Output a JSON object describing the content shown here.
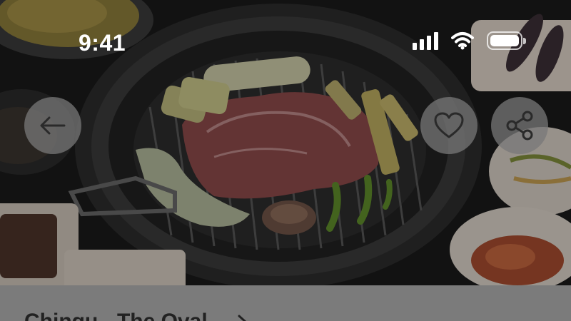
{
  "status_bar": {
    "time": "9:41",
    "icons": [
      "cellular-signal-icon",
      "wifi-icon",
      "battery-icon"
    ]
  },
  "hero": {
    "icon": "korean-bbq-grill-photo"
  },
  "actions": {
    "back_icon": "arrow-left-icon",
    "favorite_icon": "heart-icon",
    "share_icon": "share-icon"
  },
  "restaurant": {
    "name": "Chingu - The Oval"
  },
  "colors": {
    "overlay_button": "#787878",
    "sheet_background": "#7b7b7b",
    "title_text": "#222222"
  }
}
